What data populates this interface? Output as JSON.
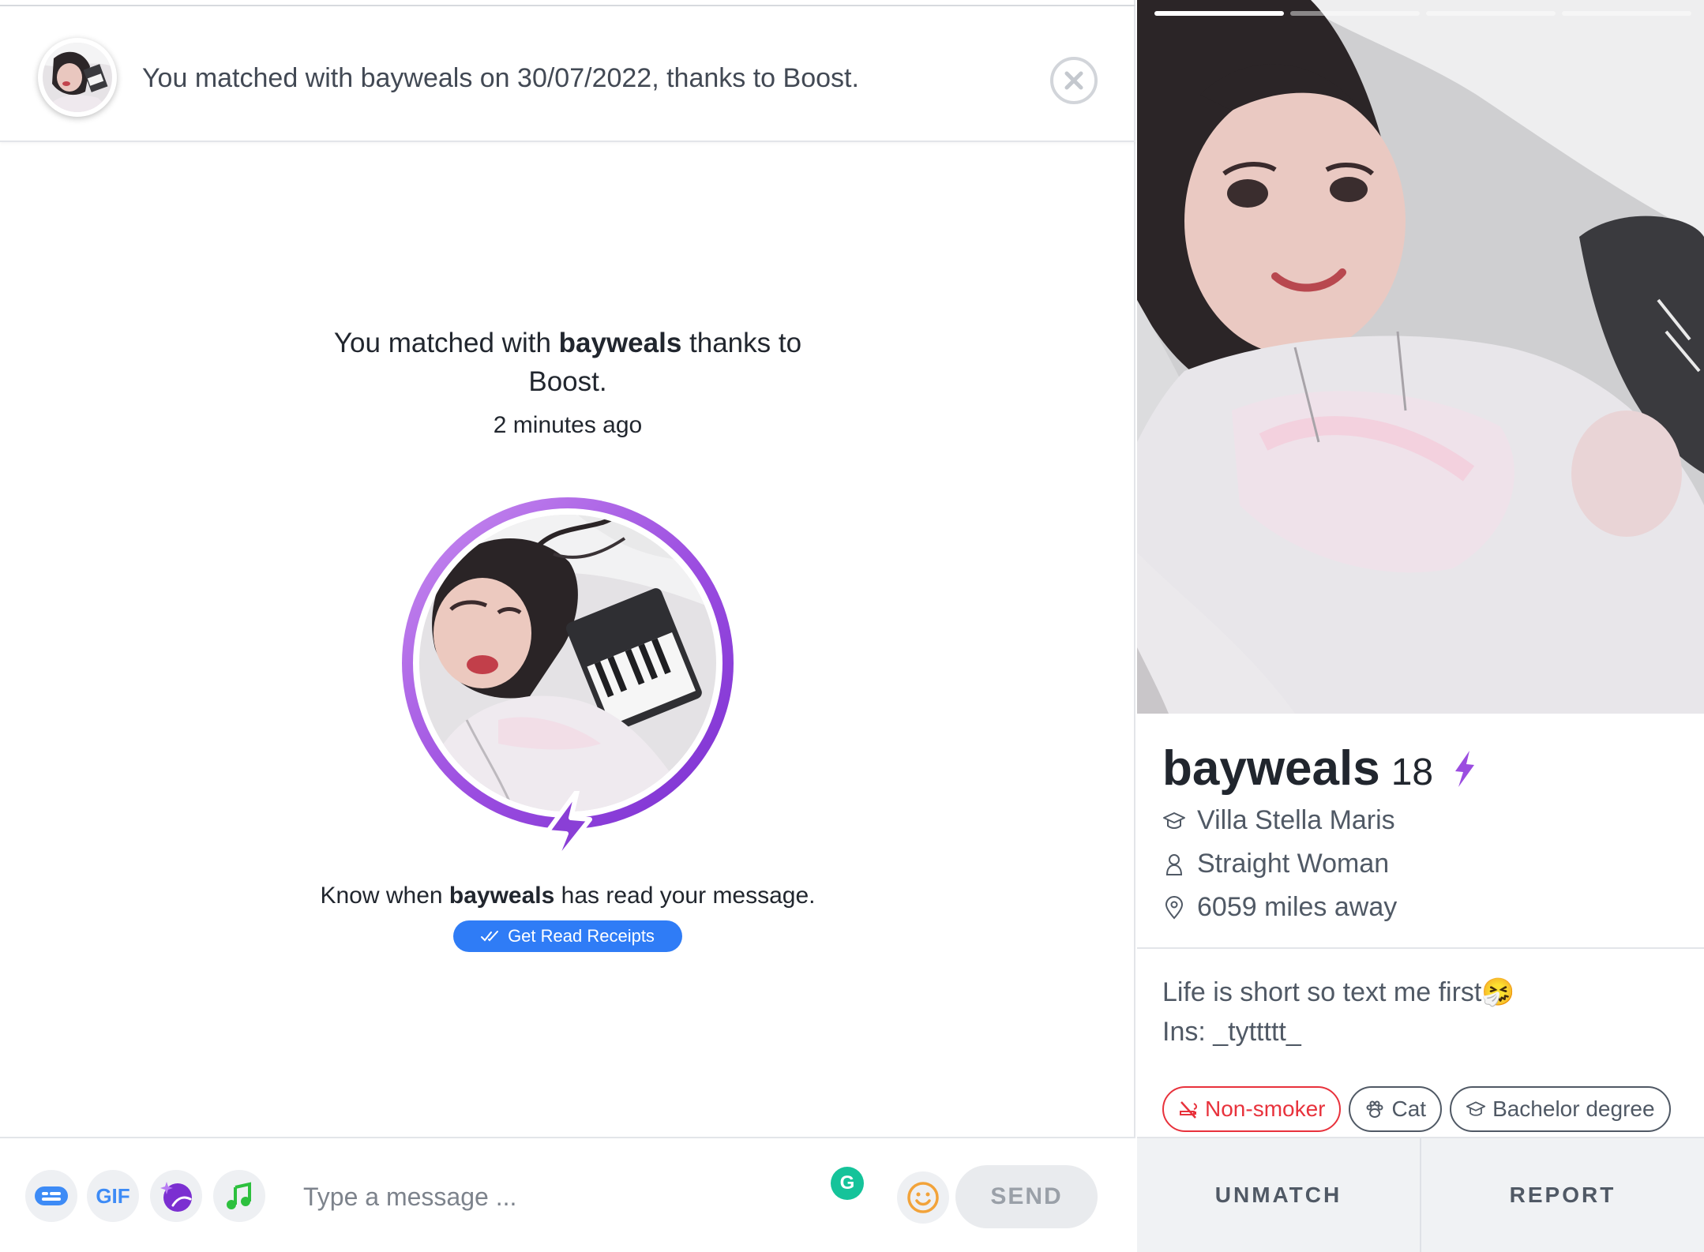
{
  "header": {
    "match_text": "You matched with bayweals on 30/07/2022, thanks to Boost."
  },
  "match_info": {
    "line_prefix": "You matched with ",
    "match_name": "bayweals",
    "line_suffix": " thanks to Boost.",
    "time": "2 minutes ago"
  },
  "read_receipts": {
    "prefix": "Know when ",
    "name": "bayweals",
    "suffix": " has read your message.",
    "button_label": "Get Read Receipts"
  },
  "composer": {
    "gif_label": "GIF",
    "placeholder": "Type a message ...",
    "send_label": "SEND",
    "grammarly_letter": "G"
  },
  "profile": {
    "photo_count": 4,
    "active_photo": 1,
    "name": "bayweals",
    "age": "18",
    "school": "Villa Stella Maris",
    "orientation": "Straight Woman",
    "distance": "6059 miles away",
    "bio_line1": "Life is short so text me first🤧",
    "bio_line2": "Ins: _tyttttt_",
    "tags": [
      {
        "label": "Non-smoker",
        "icon": "no-smoking-icon",
        "color": "#e8323c"
      },
      {
        "label": "Cat",
        "icon": "paw-icon",
        "color": "#505965"
      },
      {
        "label": "Bachelor degree",
        "icon": "graduation-cap-icon",
        "color": "#505965"
      }
    ],
    "unmatch_label": "UNMATCH",
    "report_label": "REPORT"
  },
  "colors": {
    "boost_purple": "#9b4de0",
    "read_receipts_blue": "#2f7cf6",
    "send_disabled": "#9aa0a8"
  }
}
